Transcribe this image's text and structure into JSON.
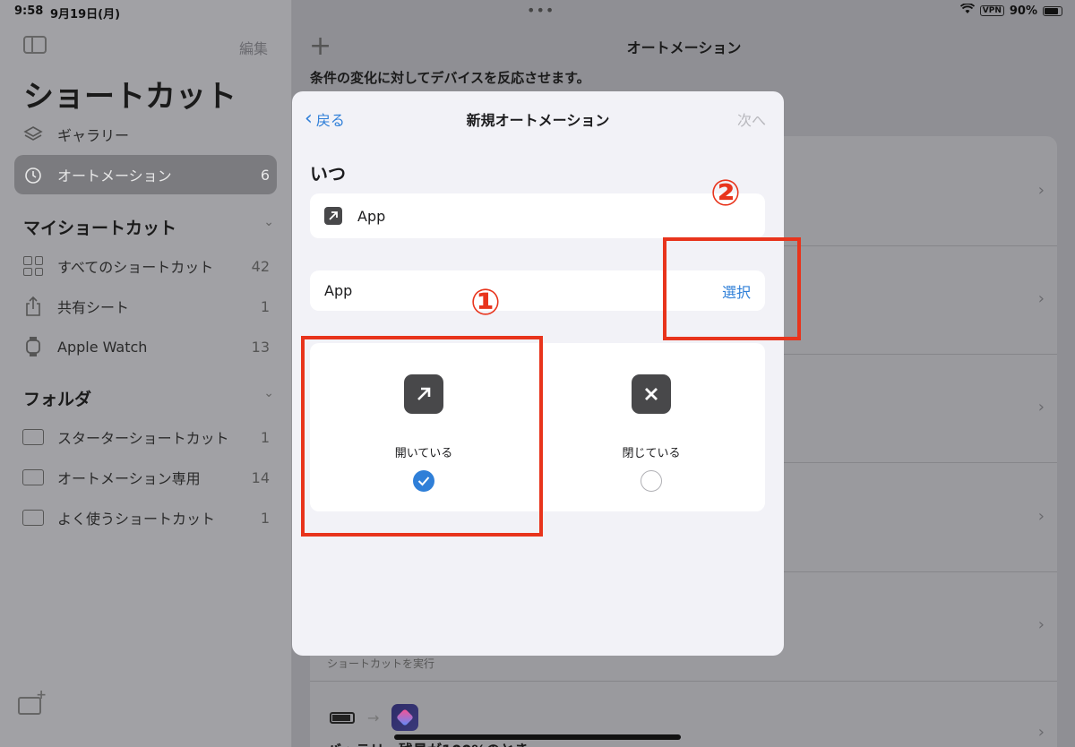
{
  "status_bar": {
    "time": "9:58",
    "date": "9月19日(月)",
    "vpn": "VPN",
    "battery": "90%"
  },
  "sidebar": {
    "edit_label": "編集",
    "title": "ショートカット",
    "items": [
      {
        "label": "ギャラリー",
        "icon": "gallery-layers-icon",
        "count": ""
      },
      {
        "label": "オートメーション",
        "icon": "automation-clock-icon",
        "count": "6"
      }
    ],
    "my_shortcuts": {
      "title": "マイショートカット",
      "items": [
        {
          "label": "すべてのショートカット",
          "icon": "grid-icon",
          "count": "42"
        },
        {
          "label": "共有シート",
          "icon": "share-icon",
          "count": "1"
        },
        {
          "label": "Apple Watch",
          "icon": "watch-icon",
          "count": "13"
        }
      ]
    },
    "folders": {
      "title": "フォルダ",
      "items": [
        {
          "label": "スターターショートカット",
          "icon": "folder-icon",
          "count": "1"
        },
        {
          "label": "オートメーション専用",
          "icon": "folder-icon",
          "count": "14"
        },
        {
          "label": "よく使うショートカット",
          "icon": "folder-icon",
          "count": "1"
        }
      ]
    }
  },
  "main": {
    "title": "オートメーション",
    "subtitle": "条件の変化に対してデバイスを反応させます。",
    "run_label": "ショートカットを実行",
    "partial_row_text": "バッテリー残量が100%のとき"
  },
  "modal": {
    "back_label": "戻る",
    "title": "新規オートメーション",
    "next_label": "次へ",
    "section_title": "いつ",
    "trigger_label": "App",
    "app_row_label": "App",
    "select_label": "選択",
    "options": [
      {
        "label": "開いている",
        "selected": true,
        "icon": "open-arrow-icon"
      },
      {
        "label": "閉じている",
        "selected": false,
        "icon": "close-x-icon"
      }
    ]
  },
  "annotations": {
    "marker1": "①",
    "marker2": "②",
    "color": "#e8341c"
  },
  "colors": {
    "accent": "#2f7fd8",
    "annotation": "#e8341c"
  }
}
